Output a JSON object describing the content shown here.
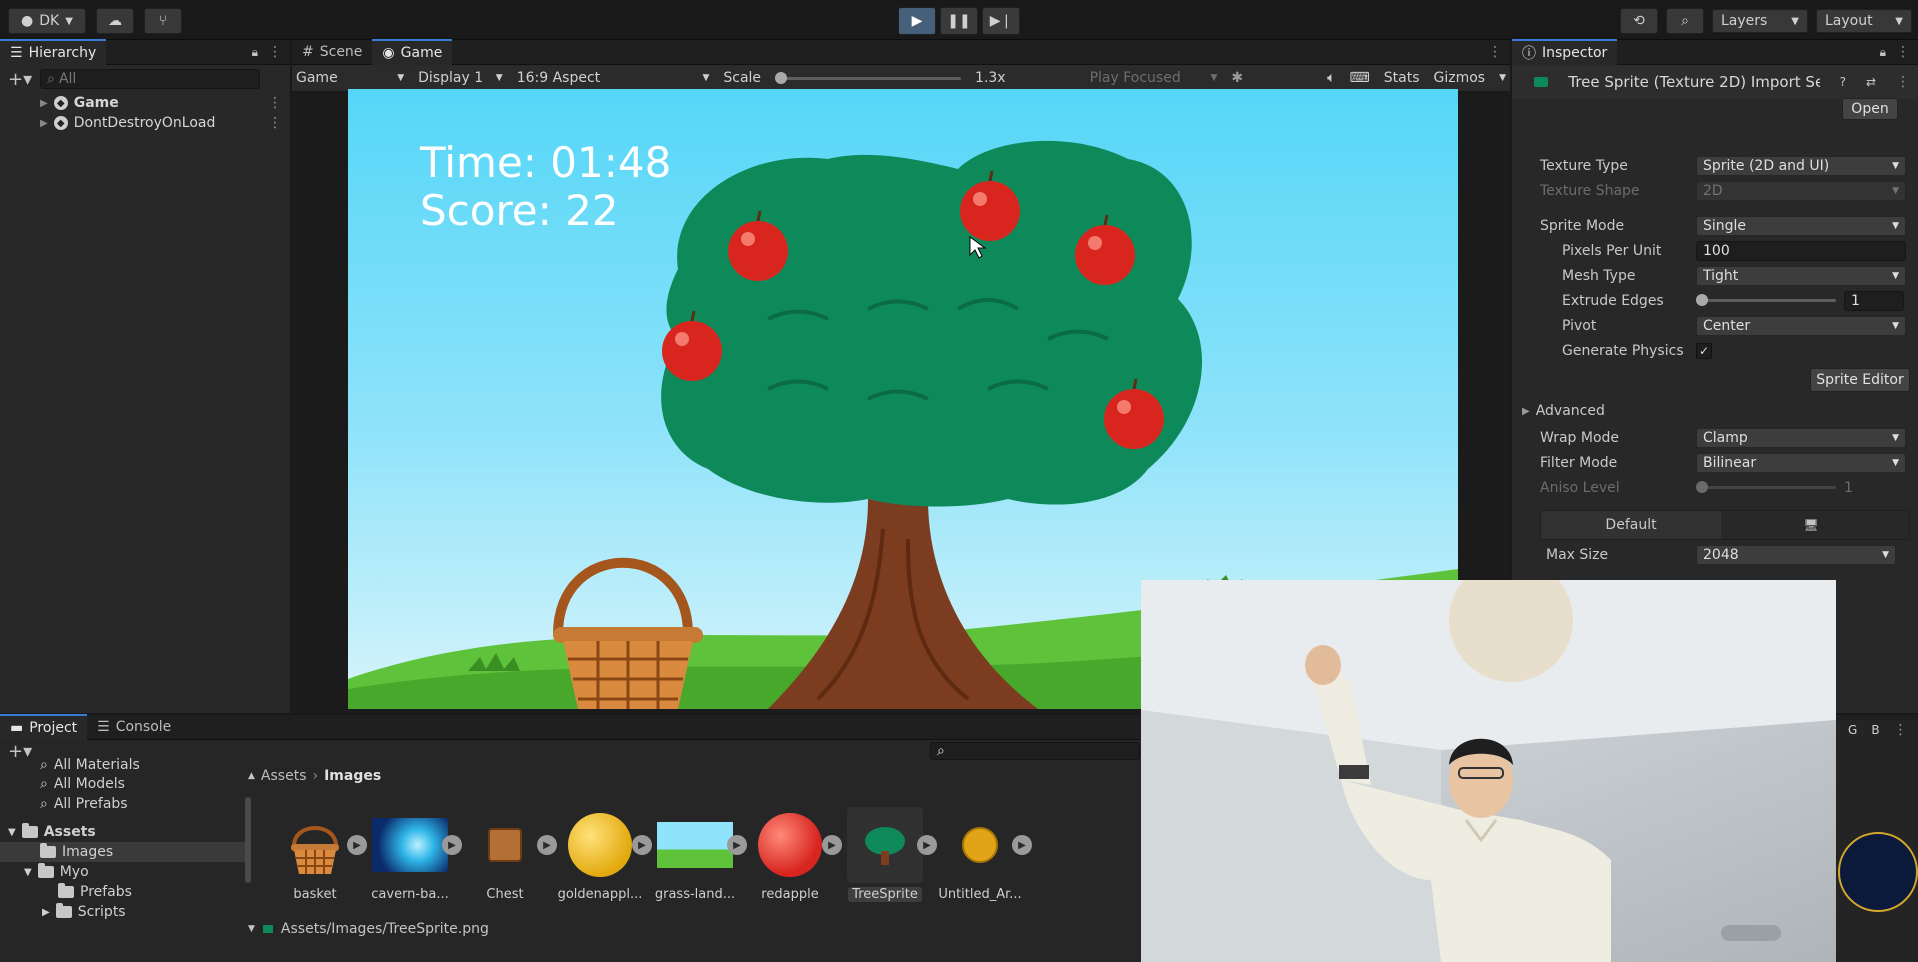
{
  "toolbar": {
    "account": "DK",
    "layers_label": "Layers",
    "layout_label": "Layout"
  },
  "hierarchy": {
    "title": "Hierarchy",
    "search_placeholder": "All",
    "items": [
      {
        "label": "Game"
      },
      {
        "label": "DontDestroyOnLoad"
      }
    ]
  },
  "view_tabs": {
    "scene": "Scene",
    "game": "Game"
  },
  "game_toolbar": {
    "mode": "Game",
    "display": "Display 1",
    "aspect": "16:9 Aspect",
    "scale_label": "Scale",
    "scale_value": "1.3x",
    "play_focused": "Play Focused",
    "stats": "Stats",
    "gizmos": "Gizmos"
  },
  "game_hud": {
    "time": "Time: 01:48",
    "score": "Score: 22"
  },
  "inspector": {
    "title": "Inspector",
    "asset_title": "Tree Sprite (Texture 2D) Import Se",
    "open_button": "Open",
    "texture_type_label": "Texture Type",
    "texture_type": "Sprite (2D and UI)",
    "texture_shape_label": "Texture Shape",
    "texture_shape": "2D",
    "sprite_mode_label": "Sprite Mode",
    "sprite_mode": "Single",
    "ppu_label": "Pixels Per Unit",
    "ppu": "100",
    "mesh_type_label": "Mesh Type",
    "mesh_type": "Tight",
    "extrude_label": "Extrude Edges",
    "extrude": "1",
    "pivot_label": "Pivot",
    "pivot": "Center",
    "gen_physics_label": "Generate Physics",
    "gen_physics_check": "✓",
    "sprite_editor_button": "Sprite Editor",
    "advanced_label": "Advanced",
    "wrap_label": "Wrap Mode",
    "wrap": "Clamp",
    "filter_label": "Filter Mode",
    "filter": "Bilinear",
    "aniso_label": "Aniso Level",
    "aniso": "1",
    "default_tab": "Default",
    "max_size_label": "Max Size",
    "max_size": "2048"
  },
  "bottom_tabs": {
    "project": "Project",
    "console": "Console"
  },
  "project_tree": {
    "favorites": [
      "All Materials",
      "All Models",
      "All Prefabs"
    ],
    "assets": "Assets",
    "images": "Images",
    "myo": "Myo",
    "prefabs": "Prefabs",
    "scripts": "Scripts"
  },
  "breadcrumb": {
    "root": "Assets",
    "current": "Images"
  },
  "assets_grid": [
    {
      "label": "basket"
    },
    {
      "label": "cavern-ba..."
    },
    {
      "label": "Chest"
    },
    {
      "label": "goldenappl..."
    },
    {
      "label": "grass-land..."
    },
    {
      "label": "redapple"
    },
    {
      "label": "TreeSprite"
    },
    {
      "label": "Untitled_Ar..."
    }
  ],
  "status_path": "Assets/Images/TreeSprite.png",
  "colors": {
    "accent": "#3a7bd5",
    "sky": "#55d6f7",
    "canopy": "#0e8a5a",
    "apple": "#d8261f",
    "trunk": "#7b3c1f"
  }
}
